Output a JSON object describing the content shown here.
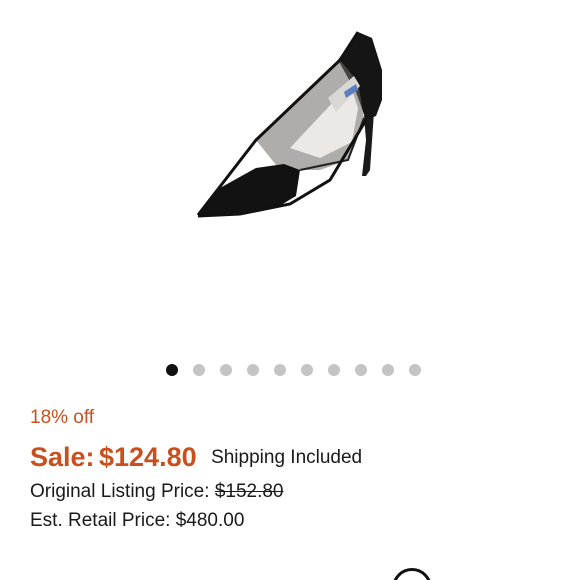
{
  "product": {
    "image_alt": "black mesh pointed-toe pump"
  },
  "carousel": {
    "total": 10,
    "active_index": 0
  },
  "pricing": {
    "discount": "18% off",
    "sale_label": "Sale:",
    "sale_price": "$124.80",
    "shipping": "Shipping Included",
    "original_label": "Original Listing Price:",
    "original_price": "$152.80",
    "retail_label": "Est. Retail Price:",
    "retail_price": "$480.00"
  },
  "colors": {
    "accent": "#c8501e",
    "dot_active": "#111111",
    "dot_inactive": "#c4c4c4"
  }
}
